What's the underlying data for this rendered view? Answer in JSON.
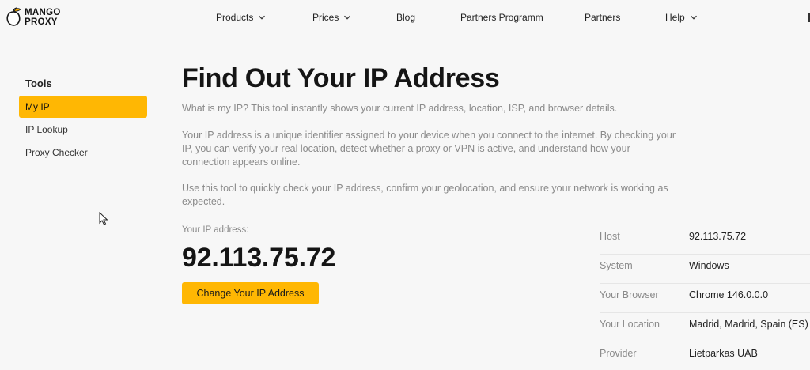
{
  "brand": {
    "line1": "MANGO",
    "line2": "PROXY",
    "accent": "#ffb703"
  },
  "nav": {
    "products": "Products",
    "prices": "Prices",
    "blog": "Blog",
    "partners_programm": "Partners Programm",
    "partners": "Partners",
    "help": "Help"
  },
  "sidebar": {
    "title": "Tools",
    "items": [
      {
        "label": "My IP",
        "active": true
      },
      {
        "label": "IP Lookup",
        "active": false
      },
      {
        "label": "Proxy Checker",
        "active": false
      }
    ]
  },
  "main": {
    "title": "Find Out Your IP Address",
    "intro": "What is my IP? This tool instantly shows your current IP address, location, ISP, and browser details.",
    "para2": "Your IP address is a unique identifier assigned to your device when you connect to the internet. By checking your IP, you can verify your real location, detect whether a proxy or VPN is active, and understand how your connection appears online.",
    "para3": "Use this tool to quickly check your IP address, confirm your geolocation, and ensure your network is working as expected.",
    "ip_label": "Your IP address:",
    "ip_value": "92.113.75.72",
    "change_button": "Change Your IP Address"
  },
  "info": [
    {
      "key": "Host",
      "value": "92.113.75.72"
    },
    {
      "key": "System",
      "value": "Windows"
    },
    {
      "key": "Your Browser",
      "value": "Chrome 146.0.0.0"
    },
    {
      "key": "Your Location",
      "value": "Madrid, Madrid, Spain (ES)"
    },
    {
      "key": "Provider",
      "value": "Lietparkas UAB"
    }
  ],
  "icons": {
    "logo": "mango-leaf-icon",
    "dropdown": "chevron-down-icon",
    "cursor": "mouse-pointer-icon"
  }
}
